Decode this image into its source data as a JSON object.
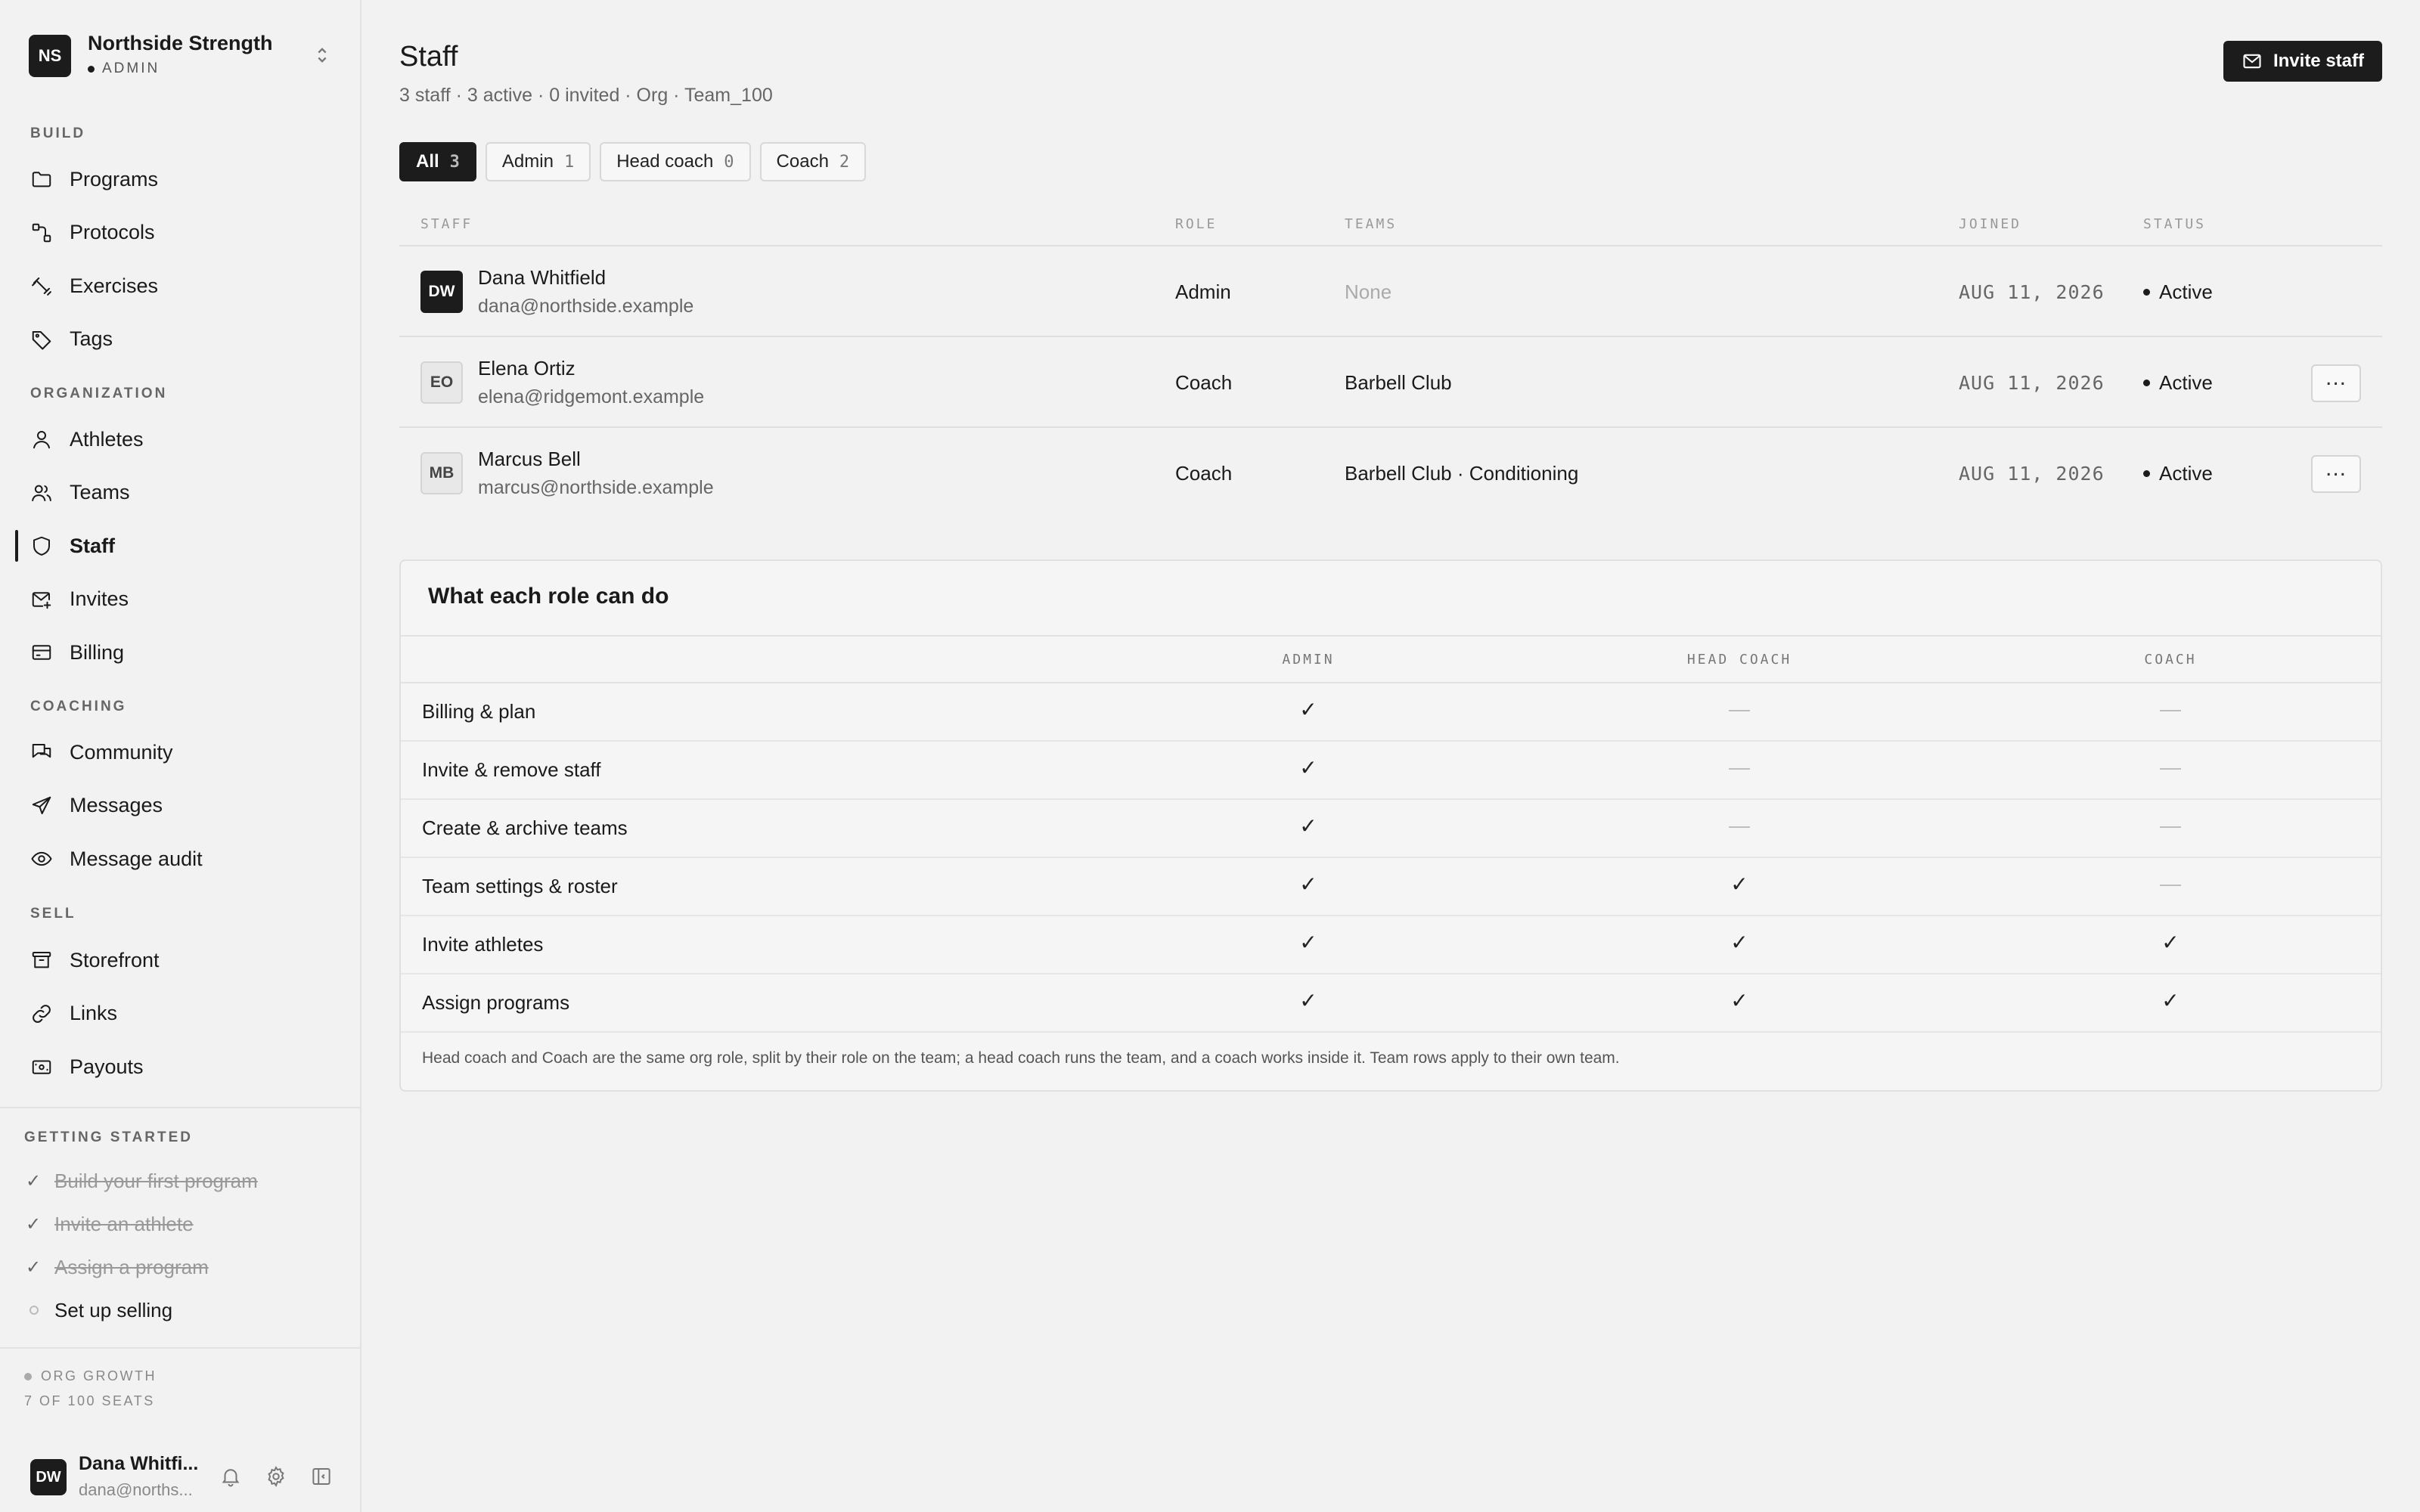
{
  "org": {
    "initials": "NS",
    "name": "Northside Strength",
    "role": "ADMIN"
  },
  "nav": {
    "build_label": "BUILD",
    "build": [
      {
        "label": "Programs",
        "icon": "folder-icon"
      },
      {
        "label": "Protocols",
        "icon": "protocol-icon"
      },
      {
        "label": "Exercises",
        "icon": "dumbbell-icon"
      },
      {
        "label": "Tags",
        "icon": "tag-icon"
      }
    ],
    "organization_label": "ORGANIZATION",
    "organization": [
      {
        "label": "Athletes",
        "icon": "user-icon"
      },
      {
        "label": "Teams",
        "icon": "users-icon"
      },
      {
        "label": "Staff",
        "icon": "shield-icon",
        "active": true
      },
      {
        "label": "Invites",
        "icon": "mail-plus-icon"
      },
      {
        "label": "Billing",
        "icon": "credit-card-icon"
      }
    ],
    "coaching_label": "COACHING",
    "coaching": [
      {
        "label": "Community",
        "icon": "chat-icon"
      },
      {
        "label": "Messages",
        "icon": "send-icon"
      },
      {
        "label": "Message audit",
        "icon": "eye-icon"
      }
    ],
    "sell_label": "SELL",
    "sell": [
      {
        "label": "Storefront",
        "icon": "archive-icon"
      },
      {
        "label": "Links",
        "icon": "link-icon"
      },
      {
        "label": "Payouts",
        "icon": "wallet-icon"
      }
    ]
  },
  "getting_started": {
    "label": "GETTING STARTED",
    "items": [
      {
        "label": "Build your first program",
        "done": true
      },
      {
        "label": "Invite an athlete",
        "done": true
      },
      {
        "label": "Assign a program",
        "done": true
      },
      {
        "label": "Set up selling",
        "done": false
      }
    ]
  },
  "growth": {
    "plan": "ORG GROWTH",
    "seats": "7 OF 100 SEATS"
  },
  "user": {
    "initials": "DW",
    "name": "Dana Whitfi...",
    "email": "dana@norths..."
  },
  "page": {
    "title": "Staff",
    "subtitle": "3 staff · 3 active · 0 invited · Org · Team_100",
    "invite_label": "Invite staff"
  },
  "filters": [
    {
      "label": "All",
      "count": "3",
      "active": true
    },
    {
      "label": "Admin",
      "count": "1"
    },
    {
      "label": "Head coach",
      "count": "0"
    },
    {
      "label": "Coach",
      "count": "2"
    }
  ],
  "staff_table": {
    "headers": {
      "staff": "STAFF",
      "role": "ROLE",
      "teams": "TEAMS",
      "joined": "JOINED",
      "status": "STATUS"
    },
    "rows": [
      {
        "initials": "DW",
        "name": "Dana Whitfield",
        "email": "dana@northside.example",
        "role": "Admin",
        "teams": "None",
        "joined": "AUG 11, 2026",
        "status": "Active",
        "dark": true,
        "menu": false
      },
      {
        "initials": "EO",
        "name": "Elena Ortiz",
        "email": "elena@ridgemont.example",
        "role": "Coach",
        "teams": "Barbell Club",
        "joined": "AUG 11, 2026",
        "status": "Active",
        "dark": false,
        "menu": true
      },
      {
        "initials": "MB",
        "name": "Marcus Bell",
        "email": "marcus@northside.example",
        "role": "Coach",
        "teams": "Barbell Club · Conditioning",
        "joined": "AUG 11, 2026",
        "status": "Active",
        "dark": false,
        "menu": true
      }
    ]
  },
  "permissions": {
    "title": "What each role can do",
    "columns": [
      "ADMIN",
      "HEAD COACH",
      "COACH"
    ],
    "rows": [
      {
        "label": "Billing & plan",
        "values": [
          true,
          false,
          false
        ]
      },
      {
        "label": "Invite & remove staff",
        "values": [
          true,
          false,
          false
        ]
      },
      {
        "label": "Create & archive teams",
        "values": [
          true,
          false,
          false
        ]
      },
      {
        "label": "Team settings & roster",
        "values": [
          true,
          true,
          false
        ]
      },
      {
        "label": "Invite athletes",
        "values": [
          true,
          true,
          true
        ]
      },
      {
        "label": "Assign programs",
        "values": [
          true,
          true,
          true
        ]
      }
    ],
    "yes_glyph": "✓",
    "no_glyph": "—",
    "note": "Head coach and Coach are the same org role, split by their role on the team; a head coach runs the team, and a coach works inside it. Team rows apply to their own team."
  }
}
